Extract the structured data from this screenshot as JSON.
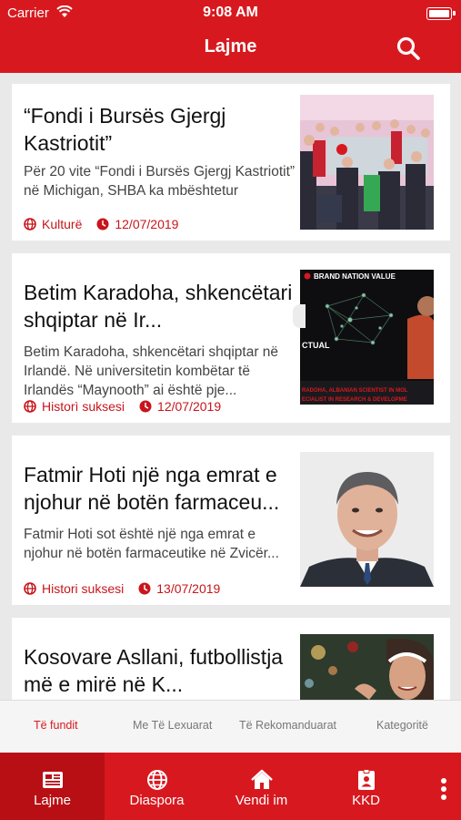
{
  "status": {
    "carrier": "Carrier",
    "time": "9:08 AM"
  },
  "header": {
    "title": "Lajme"
  },
  "articles": [
    {
      "title": "“Fondi i Bursës Gjergj Kastriotit”",
      "summary": "Për 20 vite “Fondi i Bursës Gjergj Kastriotit” në Michigan, SHBA ka mbështetur",
      "category": "Kulturë",
      "date": "12/07/2019",
      "thumb": "event-photo-thumbnail"
    },
    {
      "title": "Betim Karadoha, shkencëtari shqiptar në Ir...",
      "summary": "Betim Karadoha, shkencëtari shqiptar në Irlandë. Në universitetin kombëtar të Irlandës “Maynooth” ai është pje...",
      "category": "Historì suksesi",
      "date": "12/07/2019",
      "thumb": "brain-graphic-thumbnail"
    },
    {
      "title": "Fatmir Hoti një nga emrat e njohur në botën farmaceu...",
      "summary": "Fatmir Hoti sot është një nga emrat e njohur në botën farmaceutike në Zvicër...",
      "category": "Histori suksesi",
      "date": "13/07/2019",
      "thumb": "portrait-thumbnail"
    },
    {
      "title": "Kosovare Asllani, futbollistja më e mirë në K...",
      "summary": "",
      "category": "",
      "date": "",
      "thumb": "football-thumbnail"
    }
  ],
  "thumb_text": {
    "brand": "BRAND NATION VALUE",
    "word": "CTUAL",
    "caption1": "RADOHA, ALBANIAN SCIENTIST IN MOL",
    "caption2": "ECIALIST IN RESEARCH & DEVELOPME"
  },
  "segments": [
    "Të fundit",
    "Me Të Lexuarat",
    "Të Rekomanduarat",
    "Kategoritë"
  ],
  "tabs": [
    "Lajme",
    "Diaspora",
    "Vendi im",
    "KKD"
  ],
  "colors": {
    "brand": "#d7191f",
    "active_tab": "#b80f15"
  }
}
